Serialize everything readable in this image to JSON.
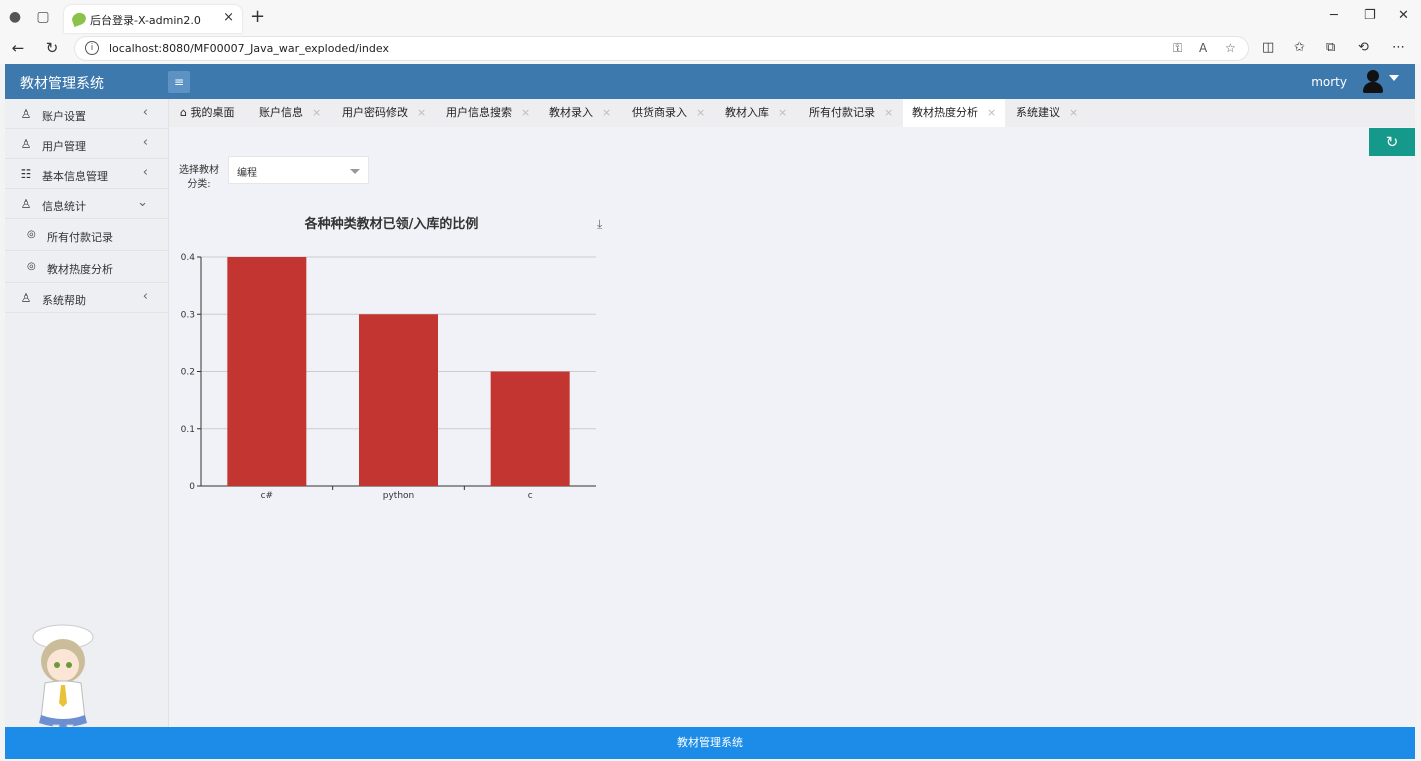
{
  "browser": {
    "tab_title": "后台登录-X-admin2.0",
    "tab_close": "×",
    "new_tab": "+",
    "url": "localhost:8080/MF00007_Java_war_exploded/index"
  },
  "app": {
    "title": "教材管理系统",
    "menu_icon": "≡",
    "user_name": "morty"
  },
  "sidebar": {
    "items": [
      {
        "label": "账户设置",
        "icon": "user-icon",
        "arrow": "‹"
      },
      {
        "label": "用户管理",
        "icon": "user-icon",
        "arrow": "‹"
      },
      {
        "label": "基本信息管理",
        "icon": "card-icon",
        "arrow": "‹"
      },
      {
        "label": "信息统计",
        "icon": "user-icon",
        "arrow": "⌄"
      },
      {
        "label": "系统帮助",
        "icon": "user-icon",
        "arrow": "‹"
      }
    ],
    "sub_items": [
      {
        "label": "所有付款记录"
      },
      {
        "label": "教材热度分析"
      }
    ]
  },
  "tabs": [
    {
      "label": "我的桌面",
      "closable": false
    },
    {
      "label": "账户信息",
      "closable": true
    },
    {
      "label": "用户密码修改",
      "closable": true
    },
    {
      "label": "用户信息搜索",
      "closable": true
    },
    {
      "label": "教材录入",
      "closable": true
    },
    {
      "label": "供货商录入",
      "closable": true
    },
    {
      "label": "教材入库",
      "closable": true
    },
    {
      "label": "所有付款记录",
      "closable": true
    },
    {
      "label": "教材热度分析",
      "closable": true,
      "active": true
    },
    {
      "label": "系统建议",
      "closable": true
    }
  ],
  "filter": {
    "label_line1": "选择教材",
    "label_line2": "分类:",
    "selected": "编程"
  },
  "chart_data": {
    "type": "bar",
    "title": "各种种类教材已领/入库的比例",
    "categories": [
      "c#",
      "python",
      "c"
    ],
    "values": [
      0.4,
      0.3,
      0.2
    ],
    "ylim": [
      0,
      0.4
    ],
    "yticks": [
      0,
      0.1,
      0.2,
      0.3,
      0.4
    ],
    "color": "#c23531",
    "grid": true
  },
  "footer": {
    "text": "教材管理系统"
  },
  "colors": {
    "header": "#3e79ae",
    "footer": "#1d8ce8",
    "refresh": "#15998a",
    "bar": "#c23531"
  }
}
